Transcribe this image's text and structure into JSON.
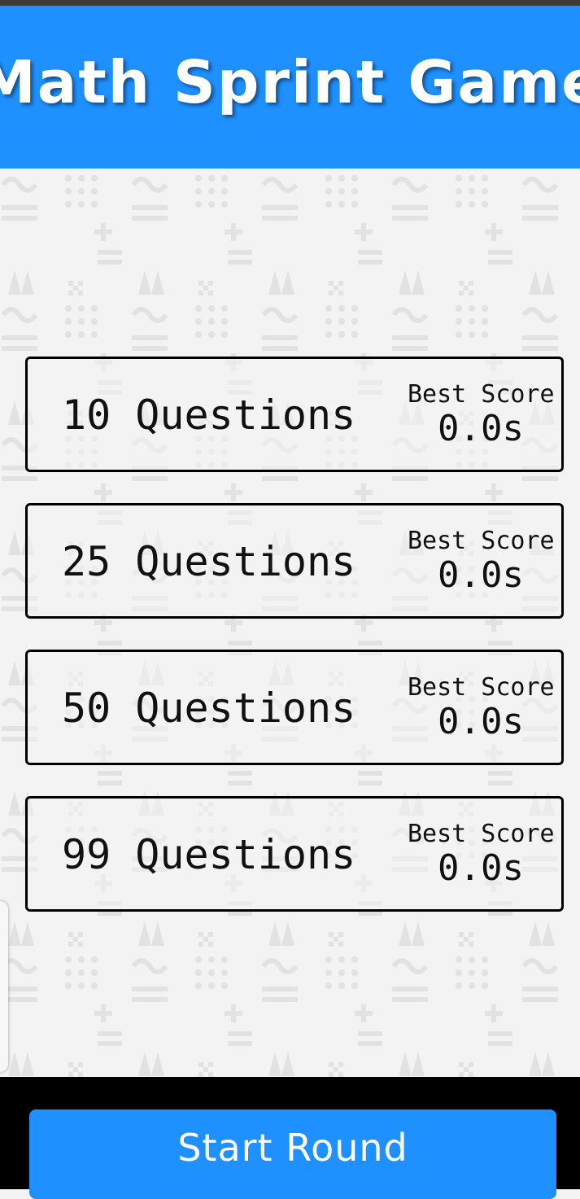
{
  "header": {
    "title": "Math Sprint Game"
  },
  "options": [
    {
      "questions_label": "10 Questions",
      "best_score_label": "Best Score",
      "best_score_value": "0.0s"
    },
    {
      "questions_label": "25 Questions",
      "best_score_label": "Best Score",
      "best_score_value": "0.0s"
    },
    {
      "questions_label": "50 Questions",
      "best_score_label": "Best Score",
      "best_score_value": "0.0s"
    },
    {
      "questions_label": "99 Questions",
      "best_score_label": "Best Score",
      "best_score_value": "0.0s"
    }
  ],
  "footer": {
    "start_label": "Start Round"
  },
  "colors": {
    "accent": "#1e90ff",
    "background": "#f3f3f3",
    "footer": "#000000"
  }
}
